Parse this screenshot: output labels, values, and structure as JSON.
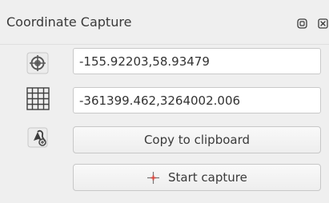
{
  "panel": {
    "title": "Coordinate Capture",
    "float_icon": "float-dock-icon",
    "close_icon": "close-icon"
  },
  "coordinates": {
    "wgs84_icon": "crosshair-globe-icon",
    "wgs84_value": "-155.92203,58.93479",
    "project_crs_icon": "grid-icon",
    "project_crs_value": "-361399.462,3264002.006",
    "tracking_icon": "mouse-tracking-icon"
  },
  "actions": {
    "copy_label": "Copy to clipboard",
    "start_label": "Start capture",
    "start_icon": "capture-crosshair-icon"
  },
  "colors": {
    "panel_bg": "#efefef",
    "field_bg": "#ffffff",
    "capture_icon": "#d6453c",
    "text": "#3a3a3a"
  }
}
